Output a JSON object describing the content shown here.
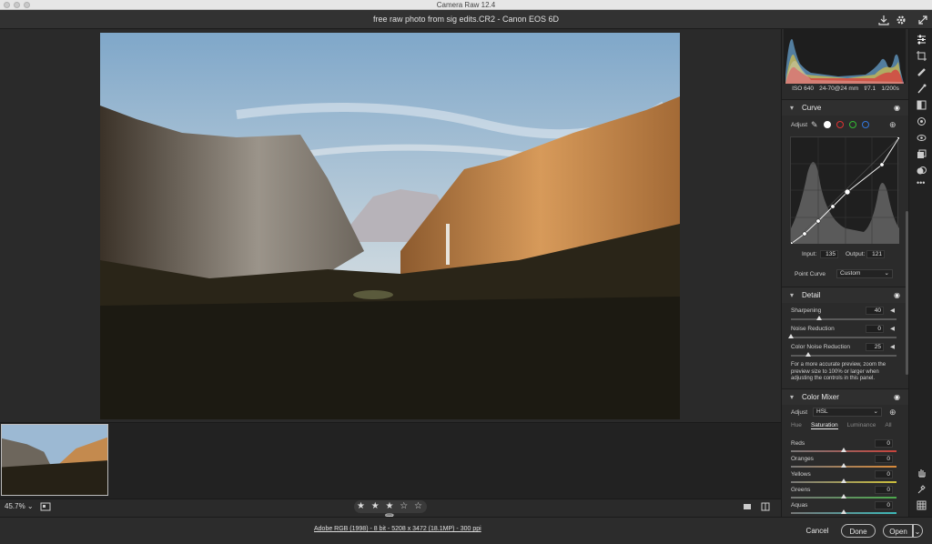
{
  "window": {
    "title": "Camera Raw 12.4"
  },
  "document": {
    "title": "free raw photo from sig edits.CR2  -  Canon EOS 6D"
  },
  "exif": {
    "iso": "ISO 640",
    "lens": "24-70@24 mm",
    "aperture": "f/7.1",
    "shutter": "1/200s"
  },
  "curve": {
    "title": "Curve",
    "adjust_label": "Adjust",
    "input_label": "Input:",
    "input_value": "135",
    "output_label": "Output:",
    "output_value": "121",
    "point_curve_label": "Point Curve",
    "point_curve_value": "Custom"
  },
  "detail": {
    "title": "Detail",
    "sharpening_label": "Sharpening",
    "sharpening_value": "40",
    "sharpening_pct": 40,
    "noise_label": "Noise Reduction",
    "noise_value": "0",
    "noise_pct": 0,
    "color_noise_label": "Color Noise Reduction",
    "color_noise_value": "25",
    "color_noise_pct": 25,
    "note": "For a more accurate preview, zoom the preview size to 100% or larger when adjusting the controls in this panel."
  },
  "color_mixer": {
    "title": "Color Mixer",
    "adjust_label": "Adjust",
    "adjust_value": "HSL",
    "tabs": [
      "Hue",
      "Saturation",
      "Luminance",
      "All"
    ],
    "active_tab": "Saturation",
    "rows": [
      {
        "label": "Reds",
        "value": "0",
        "color": "#c8443c"
      },
      {
        "label": "Oranges",
        "value": "0",
        "color": "#d98a3a"
      },
      {
        "label": "Yellows",
        "value": "0",
        "color": "#cdbf3c"
      },
      {
        "label": "Greens",
        "value": "0",
        "color": "#4caa4c"
      },
      {
        "label": "Aquas",
        "value": "0",
        "color": "#3cb8b8"
      }
    ]
  },
  "status": {
    "zoom": "45.7%"
  },
  "rating": {
    "stars": "★ ★ ★ ☆ ☆",
    "filled": 3
  },
  "bottom": {
    "workflow": "Adobe RGB (1998) - 8 bit - 5208 x 3472 (18.1MP) - 300 ppi",
    "cancel": "Cancel",
    "done": "Done",
    "open": "Open"
  },
  "colors": {
    "accent": "#1473e6",
    "panel": "#2b2b2b"
  }
}
